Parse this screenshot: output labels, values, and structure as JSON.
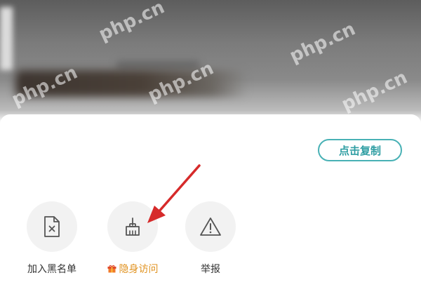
{
  "copy_button": {
    "label": "点击复制"
  },
  "actions": [
    {
      "label": "加入黑名单",
      "icon": "blacklist-document-icon"
    },
    {
      "label": "隐身访问",
      "icon": "broom-icon",
      "badge_icon": "gift-icon",
      "label_color": "#e0921f"
    },
    {
      "label": "举报",
      "icon": "warning-triangle-icon"
    }
  ],
  "watermark": "php.cn",
  "colors": {
    "accent_teal": "#48b1b5",
    "arrow_red": "#d62a2a",
    "highlight_orange": "#e0921f"
  }
}
